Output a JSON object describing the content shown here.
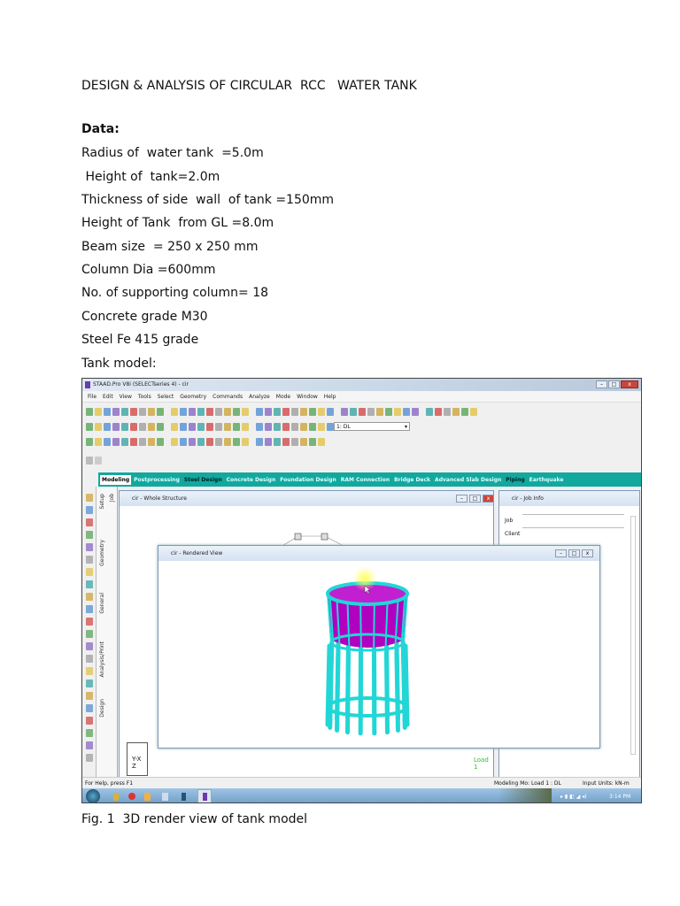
{
  "document": {
    "title": "DESIGN & ANALYSIS OF CIRCULAR  RCC   WATER TANK",
    "data_heading": "Data:",
    "lines": [
      "Radius of  water tank  =5.0m",
      " Height of  tank=2.0m",
      "Thickness of side  wall  of tank =150mm",
      "Height of Tank  from GL =8.0m",
      "Beam size  = 250 x 250 mm",
      "Column Dia =600mm",
      "No. of supporting column= 18",
      "Concrete grade M30",
      "Steel Fe 415 grade",
      "Tank model:"
    ],
    "caption": "Fig. 1  3D render view of tank model"
  },
  "app": {
    "window_title": "STAAD.Pro V8i (SELECTseries 4) - cir",
    "menu": [
      "File",
      "Edit",
      "View",
      "Tools",
      "Select",
      "Geometry",
      "Commands",
      "Analyze",
      "Mode",
      "Window",
      "Help"
    ],
    "load_select": "1: DL",
    "tabs": [
      "Modeling",
      "Postprocessing",
      "Steel Design",
      "Concrete Design",
      "Foundation Design",
      "RAM Connection",
      "Bridge Deck",
      "Advanced Slab Design",
      "Piping",
      "Earthquake"
    ],
    "vertical_tabs": [
      "Job",
      "Setup",
      "Geometry",
      "General",
      "Analysis/Print",
      "Design"
    ],
    "whole_structure_title": "cir - Whole Structure",
    "job_info_title": "cir - Job Info",
    "job_info_fields": [
      "Job",
      "Client"
    ],
    "rendered_view_title": "cir - Rendered View",
    "axis_label": "Y-X",
    "axis_label_z": "Z",
    "load_label": "Load 1",
    "status_help": "For Help, press F1",
    "status_mode": "Modeling Mo: Load 1 : DL",
    "status_units": "Input Units:  kN-m",
    "clock": "3:14 PM",
    "colors": {
      "tabs": "#12a89e",
      "tank_wall": "#b000c0",
      "structure": "#22d6d6"
    }
  }
}
